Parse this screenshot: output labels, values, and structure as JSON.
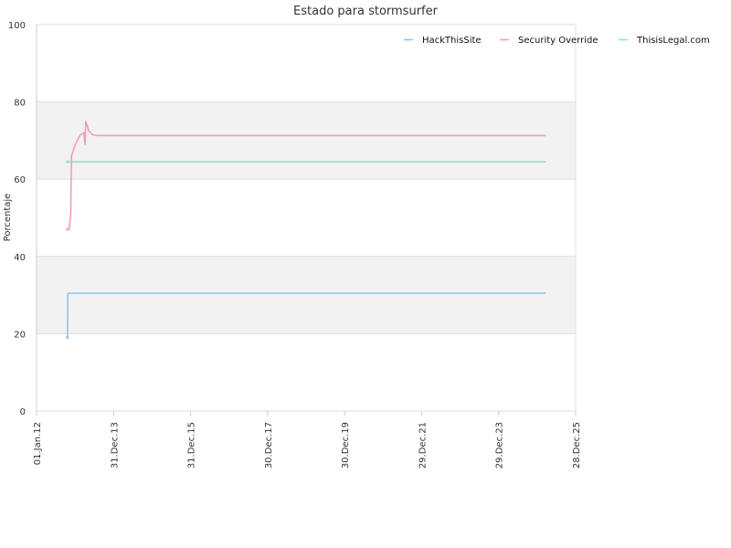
{
  "chart_data": {
    "type": "line",
    "title": "Estado para stormsurfer",
    "ylabel": "Porcentaje",
    "xlabel": "",
    "ylim": [
      0,
      100
    ],
    "yticks": [
      0,
      20,
      40,
      60,
      80,
      100
    ],
    "xlim": [
      "2012-01-01",
      "2025-12-28"
    ],
    "xticks": [
      {
        "date": "2012-01-01",
        "label": "01.Jan.12"
      },
      {
        "date": "2013-12-31",
        "label": "31.Dec.13"
      },
      {
        "date": "2015-12-31",
        "label": "31.Dec.15"
      },
      {
        "date": "2017-12-30",
        "label": "30.Dec.17"
      },
      {
        "date": "2019-12-30",
        "label": "30.Dec.19"
      },
      {
        "date": "2021-12-29",
        "label": "29.Dec.21"
      },
      {
        "date": "2023-12-29",
        "label": "29.Dec.23"
      },
      {
        "date": "2025-12-28",
        "label": "28.Dec.25"
      }
    ],
    "grid": true,
    "banded_background": true,
    "legend_position": "top-right",
    "series": [
      {
        "name": "HackThisSite",
        "color": "#8ec4e8",
        "points": [
          [
            "2012-10-20",
            19
          ],
          [
            "2012-10-24",
            30.5
          ],
          [
            "2025-03-20",
            30.5
          ]
        ]
      },
      {
        "name": "Security Override",
        "color": "#f49ac2",
        "points": [
          [
            "2012-10-20",
            47
          ],
          [
            "2012-11-05",
            47
          ],
          [
            "2012-11-20",
            51
          ],
          [
            "2012-11-28",
            66
          ],
          [
            "2012-12-20",
            68
          ],
          [
            "2013-01-20",
            70
          ],
          [
            "2013-02-20",
            71.5
          ],
          [
            "2013-03-25",
            72
          ],
          [
            "2013-04-05",
            69
          ],
          [
            "2013-04-12",
            75
          ],
          [
            "2013-05-10",
            72.5
          ],
          [
            "2013-06-15",
            71.5
          ],
          [
            "2013-08-01",
            71.3
          ],
          [
            "2025-03-20",
            71.3
          ]
        ]
      },
      {
        "name": "ThisisLegal.com",
        "color": "#8fe3cc",
        "points": [
          [
            "2012-10-20",
            64.5
          ],
          [
            "2025-03-20",
            64.5
          ]
        ]
      }
    ]
  }
}
